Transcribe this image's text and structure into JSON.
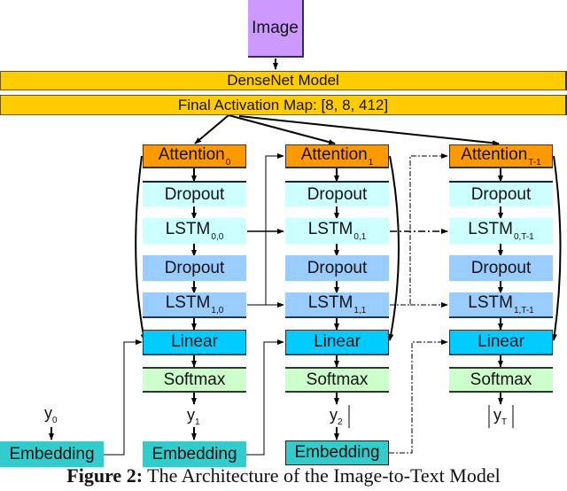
{
  "diagram": {
    "input": {
      "label": "Image",
      "color": "#cc99ff"
    },
    "encoder": {
      "label": "DenseNet Model",
      "color": "#ffcc00"
    },
    "activation_map": {
      "label": "Final Activation Map: [8, 8, 412]",
      "color": "#ffcc00"
    },
    "columns": [
      {
        "attention": {
          "base": "Attention",
          "sub": "0"
        },
        "dropout1": "Dropout",
        "lstm0": {
          "base": "LSTM",
          "sub": "0,0"
        },
        "dropout2": "Dropout",
        "lstm1": {
          "base": "LSTM",
          "sub": "1,0"
        },
        "linear": "Linear",
        "softmax": "Softmax",
        "output": {
          "base": "y",
          "sub": "1"
        }
      },
      {
        "attention": {
          "base": "Attention",
          "sub": "1"
        },
        "dropout1": "Dropout",
        "lstm0": {
          "base": "LSTM",
          "sub": "0,1"
        },
        "dropout2": "Dropout",
        "lstm1": {
          "base": "LSTM",
          "sub": "1,1"
        },
        "linear": "Linear",
        "softmax": "Softmax",
        "output": {
          "base": "y",
          "sub": "2"
        }
      },
      {
        "attention": {
          "base": "Attention",
          "sub": "T-1"
        },
        "dropout1": "Dropout",
        "lstm0": {
          "base": "LSTM",
          "sub": "0,T-1"
        },
        "dropout2": "Dropout",
        "lstm1": {
          "base": "LSTM",
          "sub": "1,T-1"
        },
        "linear": "Linear",
        "softmax": "Softmax",
        "output": {
          "base": "y",
          "sub": "T"
        }
      }
    ],
    "embeddings": [
      {
        "label": "Embedding",
        "input": {
          "base": "y",
          "sub": "0"
        }
      },
      {
        "label": "Embedding"
      },
      {
        "label": "Embedding"
      }
    ],
    "colors": {
      "attention": "#ff9900",
      "lstm_layer0": "#ccffff",
      "lstm_layer1": "#99ccff",
      "linear": "#00ccff",
      "softmax": "#ccffcc",
      "embedding": "#33cccc"
    }
  },
  "caption": {
    "prefix": "Figure 2:",
    "text": " The Architecture of the Image-to-Text Model"
  }
}
